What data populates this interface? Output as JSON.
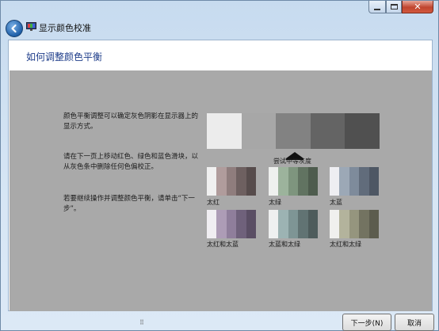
{
  "window": {
    "title": "显示颜色校准",
    "controls": {
      "minimize": "minimize-icon",
      "maximize": "maximize-icon",
      "close_glyph": "✕"
    }
  },
  "nav": {
    "back_icon": "back-arrow-icon"
  },
  "page": {
    "heading": "如何调整颜色平衡",
    "paragraphs": [
      "颜色平衡调整可以确定灰色阴影在显示器上的显示方式。",
      "请在下一页上移动红色、绿色和蓝色滑块，以从灰色条中删除任何色偏校正。",
      "若要继续操作并调整颜色平衡，请单击“下一步”。"
    ]
  },
  "illustration": {
    "main_strip_colors": [
      "#ececec",
      "#a7a7a7",
      "#828282",
      "#646464",
      "#505050"
    ],
    "pointer_label": "尝试中等灰度",
    "swatches": [
      {
        "label": "太红",
        "colors": [
          "#f0f0f0",
          "#b09c9c",
          "#8f7d7d",
          "#6e6060",
          "#574c4c"
        ]
      },
      {
        "label": "太绿",
        "colors": [
          "#eef0ee",
          "#9cb39c",
          "#7e957e",
          "#617361",
          "#4e5c4e"
        ]
      },
      {
        "label": "太蓝",
        "colors": [
          "#eeeef2",
          "#9ca8b6",
          "#7e8b9b",
          "#616c7b",
          "#4e5764"
        ]
      },
      {
        "label": "太红和太蓝",
        "colors": [
          "#f0eef2",
          "#ad9cb6",
          "#8f7e9b",
          "#6f617b",
          "#5a4e64"
        ]
      },
      {
        "label": "太蓝和太绿",
        "colors": [
          "#eef0f0",
          "#9cb3b3",
          "#7e9595",
          "#617373",
          "#4e5c5c"
        ]
      },
      {
        "label": "太红和太绿",
        "colors": [
          "#f0f0ee",
          "#b3b39c",
          "#95957e",
          "#737361",
          "#5c5c4e"
        ]
      }
    ]
  },
  "footer": {
    "next_label": "下一步(N)",
    "cancel_label": "取消"
  }
}
